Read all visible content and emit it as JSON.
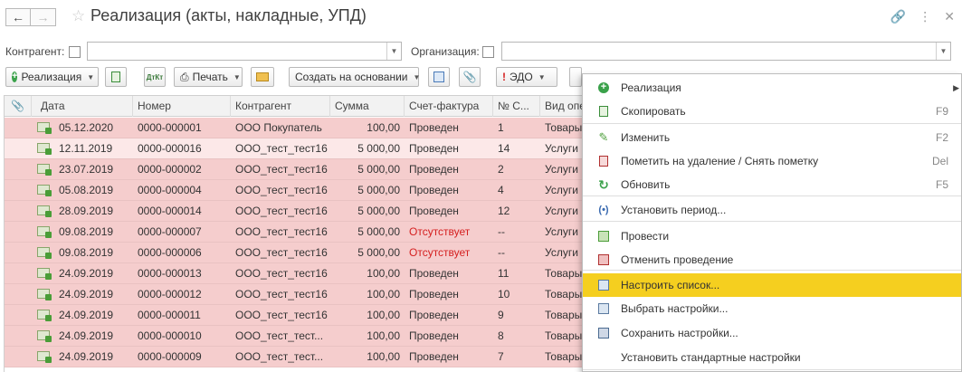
{
  "window": {
    "title": "Реализация (акты, накладные, УПД)"
  },
  "filters": {
    "counterparty_label": "Контрагент:",
    "counterparty_value": "",
    "organization_label": "Организация:",
    "organization_value": ""
  },
  "toolbar": {
    "realization": "Реализация",
    "print": "Печать",
    "create_based_on": "Создать на основании",
    "edo": "ЭДО"
  },
  "table": {
    "columns": [
      "Дата",
      "Номер",
      "Контрагент",
      "Сумма",
      "Счет-фактура",
      "№ С...",
      "Вид опе"
    ],
    "rows": [
      {
        "date": "05.12.2020",
        "number": "0000-000001",
        "counterparty": "ООО Покупатель",
        "sum": "100,00",
        "invoice": "Проведен",
        "invoice_status": "ok",
        "n": "1",
        "kind": "Товары"
      },
      {
        "date": "12.11.2019",
        "number": "0000-000016",
        "counterparty": "ООО_тест_тест16",
        "sum": "5 000,00",
        "invoice": "Проведен",
        "invoice_status": "ok",
        "n": "14",
        "kind": "Услуги"
      },
      {
        "date": "23.07.2019",
        "number": "0000-000002",
        "counterparty": "ООО_тест_тест16",
        "sum": "5 000,00",
        "invoice": "Проведен",
        "invoice_status": "ok",
        "n": "2",
        "kind": "Услуги"
      },
      {
        "date": "05.08.2019",
        "number": "0000-000004",
        "counterparty": "ООО_тест_тест16",
        "sum": "5 000,00",
        "invoice": "Проведен",
        "invoice_status": "ok",
        "n": "4",
        "kind": "Услуги"
      },
      {
        "date": "28.09.2019",
        "number": "0000-000014",
        "counterparty": "ООО_тест_тест16",
        "sum": "5 000,00",
        "invoice": "Проведен",
        "invoice_status": "ok",
        "n": "12",
        "kind": "Услуги"
      },
      {
        "date": "09.08.2019",
        "number": "0000-000007",
        "counterparty": "ООО_тест_тест16",
        "sum": "5 000,00",
        "invoice": "Отсутствует",
        "invoice_status": "missing",
        "n": "--",
        "kind": "Услуги"
      },
      {
        "date": "09.08.2019",
        "number": "0000-000006",
        "counterparty": "ООО_тест_тест16",
        "sum": "5 000,00",
        "invoice": "Отсутствует",
        "invoice_status": "missing",
        "n": "--",
        "kind": "Услуги"
      },
      {
        "date": "24.09.2019",
        "number": "0000-000013",
        "counterparty": "ООО_тест_тест16",
        "sum": "100,00",
        "invoice": "Проведен",
        "invoice_status": "ok",
        "n": "11",
        "kind": "Товары"
      },
      {
        "date": "24.09.2019",
        "number": "0000-000012",
        "counterparty": "ООО_тест_тест16",
        "sum": "100,00",
        "invoice": "Проведен",
        "invoice_status": "ok",
        "n": "10",
        "kind": "Товары"
      },
      {
        "date": "24.09.2019",
        "number": "0000-000011",
        "counterparty": "ООО_тест_тест16",
        "sum": "100,00",
        "invoice": "Проведен",
        "invoice_status": "ok",
        "n": "9",
        "kind": "Товары"
      },
      {
        "date": "24.09.2019",
        "number": "0000-000010",
        "counterparty": "ООО_тест_тест...",
        "sum": "100,00",
        "invoice": "Проведен",
        "invoice_status": "ok",
        "n": "8",
        "kind": "Товары"
      },
      {
        "date": "24.09.2019",
        "number": "0000-000009",
        "counterparty": "ООО_тест_тест...",
        "sum": "100,00",
        "invoice": "Проведен",
        "invoice_status": "ok",
        "n": "7",
        "kind": "Товары"
      }
    ]
  },
  "context_menu": {
    "items": [
      {
        "label": "Реализация",
        "key": "",
        "icon": "add-icon",
        "submenu": true
      },
      {
        "label": "Скопировать",
        "key": "F9",
        "icon": "copy-icon"
      },
      {
        "label": "Изменить",
        "key": "F2",
        "icon": "edit-icon"
      },
      {
        "label": "Пометить на удаление / Снять пометку",
        "key": "Del",
        "icon": "delete-mark-icon"
      },
      {
        "label": "Обновить",
        "key": "F5",
        "icon": "refresh-icon"
      },
      {
        "label": "Установить период...",
        "key": "",
        "icon": "period-icon"
      },
      {
        "label": "Провести",
        "key": "",
        "icon": "post-icon"
      },
      {
        "label": "Отменить проведение",
        "key": "",
        "icon": "unpost-icon"
      },
      {
        "label": "Настроить список...",
        "key": "",
        "icon": "settings-list-icon",
        "highlighted": true
      },
      {
        "label": "Выбрать настройки...",
        "key": "",
        "icon": "choose-settings-icon"
      },
      {
        "label": "Сохранить настройки...",
        "key": "",
        "icon": "save-settings-icon"
      },
      {
        "label": "Установить стандартные настройки",
        "key": "",
        "icon": ""
      }
    ]
  },
  "colors": {
    "row_pink": "#f5cdcd",
    "row_selected": "#fce8e8",
    "missing_text": "#d52020",
    "menu_highlight": "#f5cf1f",
    "accent_green": "#3aa14a"
  }
}
